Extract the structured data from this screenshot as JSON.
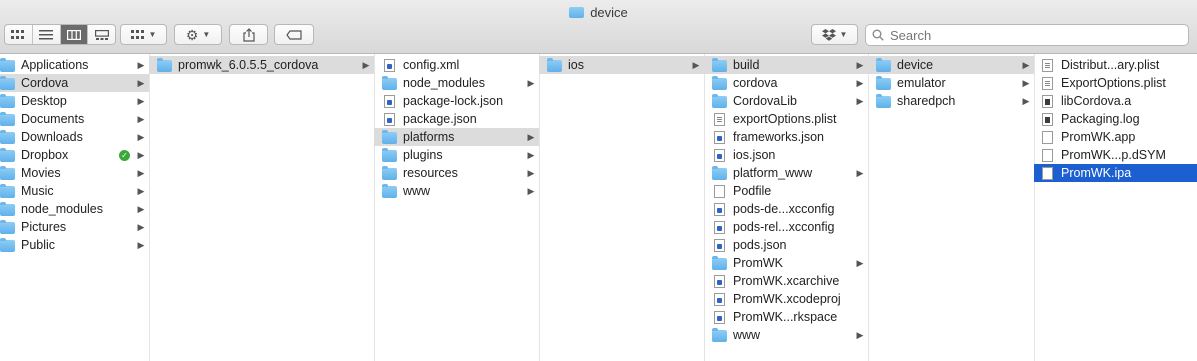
{
  "window": {
    "title": "device"
  },
  "toolbar": {
    "view_modes": [
      "icon-view",
      "list-view",
      "column-view",
      "gallery-view"
    ],
    "active_view": "column-view",
    "search_placeholder": "Search"
  },
  "columns": [
    {
      "items": [
        {
          "label": "Applications",
          "icon": "applications-folder-icon",
          "arrow": true
        },
        {
          "label": "Cordova",
          "icon": "folder-icon",
          "arrow": true,
          "selected": "grey"
        },
        {
          "label": "Desktop",
          "icon": "desktop-folder-icon",
          "arrow": true
        },
        {
          "label": "Documents",
          "icon": "documents-folder-icon",
          "arrow": true
        },
        {
          "label": "Downloads",
          "icon": "downloads-folder-icon",
          "arrow": true
        },
        {
          "label": "Dropbox",
          "icon": "dropbox-folder-icon",
          "arrow": true,
          "synced": true
        },
        {
          "label": "Movies",
          "icon": "movies-folder-icon",
          "arrow": true
        },
        {
          "label": "Music",
          "icon": "music-folder-icon",
          "arrow": true
        },
        {
          "label": "node_modules",
          "icon": "folder-icon",
          "arrow": true
        },
        {
          "label": "Pictures",
          "icon": "pictures-folder-icon",
          "arrow": true
        },
        {
          "label": "Public",
          "icon": "public-folder-icon",
          "arrow": true
        }
      ]
    },
    {
      "items": [
        {
          "label": "promwk_6.0.5.5_cordova",
          "icon": "folder-icon",
          "arrow": true,
          "selected": "grey"
        }
      ]
    },
    {
      "items": [
        {
          "label": "config.xml",
          "icon": "xml-file-icon",
          "arrow": false
        },
        {
          "label": "node_modules",
          "icon": "folder-icon",
          "arrow": true
        },
        {
          "label": "package-lock.json",
          "icon": "json-file-icon",
          "arrow": false
        },
        {
          "label": "package.json",
          "icon": "json-file-icon",
          "arrow": false
        },
        {
          "label": "platforms",
          "icon": "folder-icon",
          "arrow": true,
          "selected": "grey"
        },
        {
          "label": "plugins",
          "icon": "folder-icon",
          "arrow": true
        },
        {
          "label": "resources",
          "icon": "folder-icon",
          "arrow": true
        },
        {
          "label": "www",
          "icon": "folder-icon",
          "arrow": true
        }
      ]
    },
    {
      "items": [
        {
          "label": "ios",
          "icon": "folder-icon",
          "arrow": true,
          "selected": "grey"
        }
      ]
    },
    {
      "items": [
        {
          "label": "build",
          "icon": "folder-icon",
          "arrow": true,
          "selected": "grey"
        },
        {
          "label": "cordova",
          "icon": "folder-icon",
          "arrow": true
        },
        {
          "label": "CordovaLib",
          "icon": "folder-icon",
          "arrow": true
        },
        {
          "label": "exportOptions.plist",
          "icon": "plist-file-icon",
          "arrow": false
        },
        {
          "label": "frameworks.json",
          "icon": "json-file-icon",
          "arrow": false
        },
        {
          "label": "ios.json",
          "icon": "json-file-icon",
          "arrow": false
        },
        {
          "label": "platform_www",
          "icon": "folder-icon",
          "arrow": true
        },
        {
          "label": "Podfile",
          "icon": "text-file-icon",
          "arrow": false
        },
        {
          "label": "pods-de...xcconfig",
          "icon": "xcconfig-file-icon",
          "arrow": false
        },
        {
          "label": "pods-rel...xcconfig",
          "icon": "xcconfig-file-icon",
          "arrow": false
        },
        {
          "label": "pods.json",
          "icon": "json-file-icon",
          "arrow": false
        },
        {
          "label": "PromWK",
          "icon": "folder-icon",
          "arrow": true
        },
        {
          "label": "PromWK.xcarchive",
          "icon": "xcarchive-file-icon",
          "arrow": false
        },
        {
          "label": "PromWK.xcodeproj",
          "icon": "xcodeproj-file-icon",
          "arrow": false
        },
        {
          "label": "PromWK...rkspace",
          "icon": "xcworkspace-file-icon",
          "arrow": false
        },
        {
          "label": "www",
          "icon": "folder-icon",
          "arrow": true
        }
      ]
    },
    {
      "items": [
        {
          "label": "device",
          "icon": "folder-icon",
          "arrow": true,
          "selected": "grey"
        },
        {
          "label": "emulator",
          "icon": "folder-icon",
          "arrow": true
        },
        {
          "label": "sharedpch",
          "icon": "folder-icon",
          "arrow": true
        }
      ]
    },
    {
      "items": [
        {
          "label": "Distribut...ary.plist",
          "icon": "plist-file-icon",
          "arrow": false
        },
        {
          "label": "ExportOptions.plist",
          "icon": "plist-file-icon",
          "arrow": false
        },
        {
          "label": "libCordova.a",
          "icon": "exec-file-icon",
          "arrow": false
        },
        {
          "label": "Packaging.log",
          "icon": "log-file-icon",
          "arrow": false
        },
        {
          "label": "PromWK.app",
          "icon": "app-file-icon",
          "arrow": false
        },
        {
          "label": "PromWK...p.dSYM",
          "icon": "dsym-file-icon",
          "arrow": false
        },
        {
          "label": "PromWK.ipa",
          "icon": "ipa-file-icon",
          "arrow": false,
          "selected": "blue"
        }
      ]
    }
  ]
}
